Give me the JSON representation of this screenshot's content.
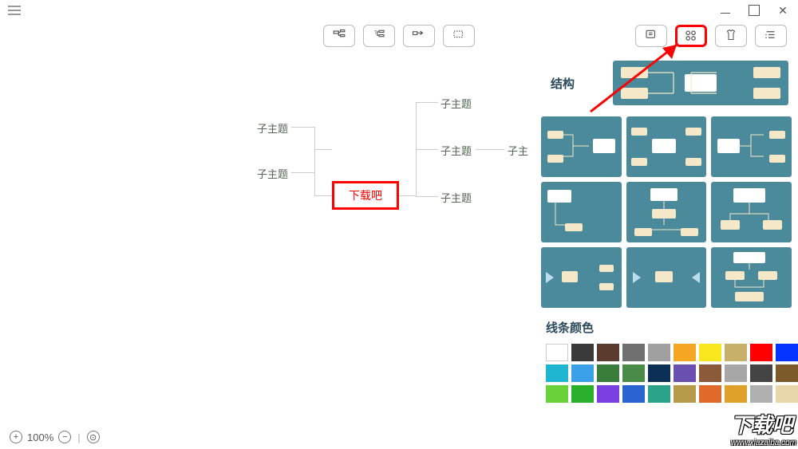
{
  "center_label": "下载吧",
  "nodes": {
    "left1": "子主题",
    "left2": "子主题",
    "right1": "子主题",
    "right2": "子主题",
    "right3": "子主题",
    "far_right": "子主"
  },
  "sidepanel": {
    "structure_title": "结构",
    "line_color_title": "线条颜色"
  },
  "status": {
    "zoom_label": "100%"
  },
  "colors_row1": [
    "#ffffff",
    "#3a3a3a",
    "#5a3b2e",
    "#707070",
    "#a0a0a0",
    "#f5a623",
    "#f8e71c",
    "#c6b06a",
    "#ff0000",
    "#0433ff"
  ],
  "colors_row2": [
    "#1fb6d1",
    "#3aa0e8",
    "#3a7d3a",
    "#4a8b4a",
    "#0b2f55",
    "#6a4fb0",
    "#8a5a3a",
    "#a7a7a7",
    "#444444",
    "#7d5a2a"
  ],
  "colors_row3": [
    "#6bd13a",
    "#2aaf2a",
    "#7a3fe0",
    "#2a64d1",
    "#2aa38a",
    "#b59a4a",
    "#e06a2a",
    "#e0a12a",
    "#b0b0b0",
    "#e8d7a8"
  ],
  "watermark": {
    "text": "下载吧",
    "url": "www.xiazaiba.com"
  }
}
